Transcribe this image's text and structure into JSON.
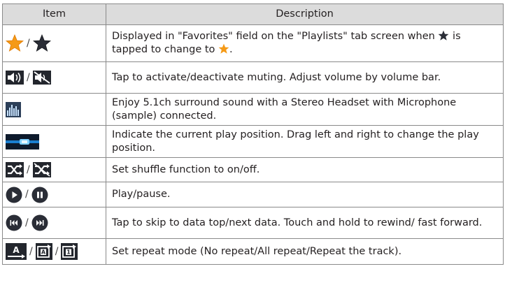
{
  "header": {
    "col1": "Item",
    "col2": "Description"
  },
  "separator": "/",
  "rows": [
    {
      "icons": [
        "star-orange-icon",
        "star-dark-icon"
      ],
      "desc_a": "Displayed in \"Favorites\" field on the \"Playlists\" tab screen when ",
      "desc_b": " is tapped to change to ",
      "desc_c": "."
    },
    {
      "icons": [
        "speaker-icon",
        "mute-icon"
      ],
      "desc": "Tap to activate/deactivate muting. Adjust volume by volume bar."
    },
    {
      "icons": [
        "surround-icon"
      ],
      "desc": "Enjoy 5.1ch surround sound with a Stereo Headset with Microphone (sample) connected."
    },
    {
      "icons": [
        "play-position-bar-icon"
      ],
      "desc": "Indicate the current play position. Drag left and right to change the play position."
    },
    {
      "icons": [
        "shuffle-on-icon",
        "shuffle-off-icon"
      ],
      "desc": "Set shuffle function to on/off."
    },
    {
      "icons": [
        "play-icon",
        "pause-icon"
      ],
      "desc": "Play/pause."
    },
    {
      "icons": [
        "previous-icon",
        "next-icon"
      ],
      "desc": "Tap to skip to data top/next data. Touch and hold to rewind/ fast forward."
    },
    {
      "icons": [
        "repeat-off-icon",
        "repeat-all-icon",
        "repeat-one-icon"
      ],
      "icon_letters": [
        "A",
        "A",
        "1"
      ],
      "desc": "Set repeat mode (No repeat/All repeat/Repeat the track)."
    }
  ],
  "colors": {
    "header_bg": "#dcdcdc",
    "border": "#8a8a8a",
    "star": "#f59a17",
    "icon_dark": "#2a2d36",
    "bar_blue": "#1a7fd0"
  }
}
